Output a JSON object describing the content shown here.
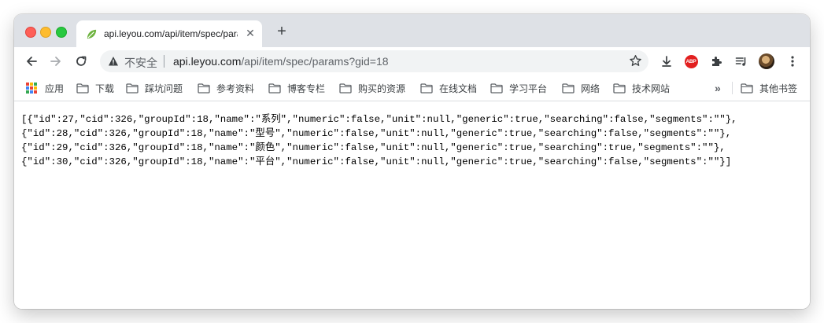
{
  "tab": {
    "title": "api.leyou.com/api/item/spec/params?gid=18",
    "close_icon": "close-icon",
    "favicon": "leaf-icon"
  },
  "new_tab_icon": "plus-icon",
  "omnibox": {
    "security_label": "不安全",
    "url_host": "api.leyou.com",
    "url_path": "/api/item/spec/params?gid=18"
  },
  "bookmarks": {
    "items": [
      {
        "label": "应用",
        "icon": "apps-icon"
      },
      {
        "label": "下载",
        "icon": "folder-icon"
      },
      {
        "label": "踩坑问题",
        "icon": "folder-icon"
      },
      {
        "label": "参考资料",
        "icon": "folder-icon"
      },
      {
        "label": "博客专栏",
        "icon": "folder-icon"
      },
      {
        "label": "购买的资源",
        "icon": "folder-icon"
      },
      {
        "label": "在线文档",
        "icon": "folder-icon"
      },
      {
        "label": "学习平台",
        "icon": "folder-icon"
      },
      {
        "label": "网络",
        "icon": "folder-icon"
      },
      {
        "label": "技术网站",
        "icon": "folder-icon"
      }
    ],
    "overflow": "»",
    "other": "其他书签"
  },
  "content": {
    "lines": [
      "[{\"id\":27,\"cid\":326,\"groupId\":18,\"name\":\"系列\",\"numeric\":false,\"unit\":null,\"generic\":true,\"searching\":false,\"segments\":\"\"},",
      "{\"id\":28,\"cid\":326,\"groupId\":18,\"name\":\"型号\",\"numeric\":false,\"unit\":null,\"generic\":true,\"searching\":false,\"segments\":\"\"},",
      "{\"id\":29,\"cid\":326,\"groupId\":18,\"name\":\"颜色\",\"numeric\":false,\"unit\":null,\"generic\":true,\"searching\":true,\"segments\":\"\"},",
      "{\"id\":30,\"cid\":326,\"groupId\":18,\"name\":\"平台\",\"numeric\":false,\"unit\":null,\"generic\":true,\"searching\":false,\"segments\":\"\"}]"
    ]
  },
  "colors": {
    "tabstrip": "#dee1e6",
    "close": "#fe5f57",
    "minimize": "#febc2e",
    "maximize": "#28c840",
    "abp": "#e21f1f"
  }
}
